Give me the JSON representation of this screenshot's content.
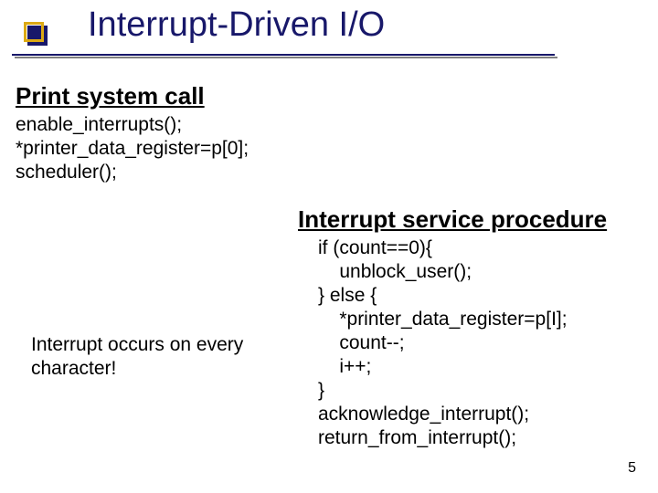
{
  "title": "Interrupt-Driven I/O",
  "section1": {
    "heading": "Print system call",
    "code": "enable_interrupts();\n*printer_data_register=p[0];\nscheduler();"
  },
  "section2": {
    "heading": "Interrupt service procedure",
    "code": "if (count==0){\n    unblock_user();\n} else {\n    *printer_data_register=p[I];\n    count--;\n    i++;\n}\nacknowledge_interrupt();\nreturn_from_interrupt();"
  },
  "note": "Interrupt occurs on every character!",
  "page_number": "5"
}
